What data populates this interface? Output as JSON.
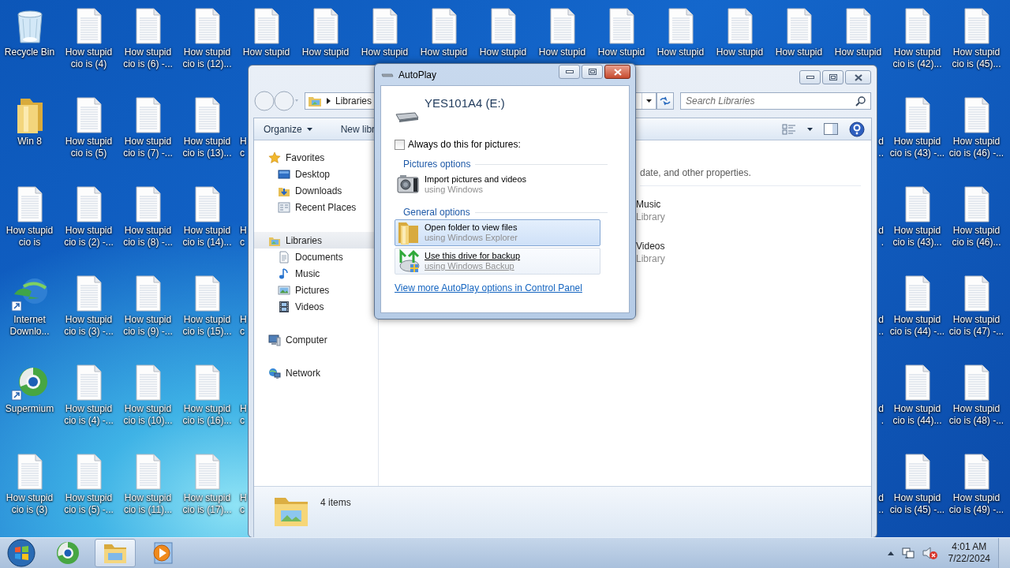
{
  "desktop": {
    "columns": [
      [
        {
          "kind": "recycle-bin",
          "lines": [
            "Recycle Bin"
          ]
        },
        {
          "kind": "folder",
          "lines": [
            "Win 8"
          ]
        },
        {
          "kind": "document",
          "lines": [
            "How stupid",
            "cio is"
          ]
        },
        {
          "kind": "downloader",
          "lines": [
            "Internet",
            "Downlo..."
          ]
        },
        {
          "kind": "browser",
          "lines": [
            "Supermium"
          ]
        },
        {
          "kind": "document",
          "lines": [
            "How stupid",
            "cio is (3)"
          ]
        }
      ],
      [
        {
          "kind": "document",
          "lines": [
            "How stupid",
            "cio is (4)"
          ]
        },
        {
          "kind": "document",
          "lines": [
            "How stupid",
            "cio is (5)"
          ]
        },
        {
          "kind": "document",
          "lines": [
            "How stupid",
            "cio is (2) -..."
          ]
        },
        {
          "kind": "document",
          "lines": [
            "How stupid",
            "cio is (3) -..."
          ]
        },
        {
          "kind": "document",
          "lines": [
            "How stupid",
            "cio is (4) -..."
          ]
        },
        {
          "kind": "document",
          "lines": [
            "How stupid",
            "cio is (5) -..."
          ]
        }
      ],
      [
        {
          "kind": "document",
          "lines": [
            "How stupid",
            "cio is (6) -..."
          ]
        },
        {
          "kind": "document",
          "lines": [
            "How stupid",
            "cio is (7) -..."
          ]
        },
        {
          "kind": "document",
          "lines": [
            "How stupid",
            "cio is (8) -..."
          ]
        },
        {
          "kind": "document",
          "lines": [
            "How stupid",
            "cio is (9) -..."
          ]
        },
        {
          "kind": "document",
          "lines": [
            "How stupid",
            "cio is (10)..."
          ]
        },
        {
          "kind": "document",
          "lines": [
            "How stupid",
            "cio is (11)..."
          ]
        }
      ],
      [
        {
          "kind": "document",
          "lines": [
            "How stupid",
            "cio is (12)..."
          ]
        },
        {
          "kind": "document",
          "lines": [
            "How stupid",
            "cio is (13)..."
          ]
        },
        {
          "kind": "document",
          "lines": [
            "How stupid",
            "cio is (14)..."
          ]
        },
        {
          "kind": "document",
          "lines": [
            "How stupid",
            "cio is (15)..."
          ]
        },
        {
          "kind": "document",
          "lines": [
            "How stupid",
            "cio is (16)..."
          ]
        },
        {
          "kind": "document",
          "lines": [
            "How stupid",
            "cio is (17)..."
          ]
        }
      ],
      [
        {
          "kind": "document",
          "lines": [
            "How stupid"
          ]
        },
        {
          "kind": "cut-left",
          "lines": [
            "H",
            "c"
          ]
        },
        {
          "kind": "cut-left",
          "lines": [
            "H",
            "c"
          ]
        },
        {
          "kind": "cut-left",
          "lines": [
            "H",
            "c"
          ]
        },
        {
          "kind": "cut-left",
          "lines": [
            "H",
            "c"
          ]
        },
        {
          "kind": "cut-left",
          "lines": [
            "H",
            "c"
          ]
        }
      ],
      [
        {
          "kind": "document",
          "lines": [
            "How stupid"
          ]
        }
      ],
      [
        {
          "kind": "document",
          "lines": [
            "How stupid"
          ]
        }
      ],
      [
        {
          "kind": "document",
          "lines": [
            "How stupid"
          ]
        }
      ],
      [
        {
          "kind": "document",
          "lines": [
            "How stupid"
          ]
        }
      ],
      [
        {
          "kind": "document",
          "lines": [
            "How stupid"
          ]
        }
      ],
      [
        {
          "kind": "document",
          "lines": [
            "How stupid"
          ]
        }
      ],
      [
        {
          "kind": "document",
          "lines": [
            "How stupid"
          ]
        }
      ],
      [
        {
          "kind": "document",
          "lines": [
            "How stupid"
          ]
        }
      ],
      [
        {
          "kind": "document",
          "lines": [
            "How stupid"
          ]
        }
      ],
      [
        {
          "kind": "document",
          "lines": [
            "How stupid"
          ]
        },
        {
          "kind": "cut-right",
          "lines": [
            "d",
            ".."
          ]
        },
        {
          "kind": "cut-right",
          "lines": [
            "d",
            "."
          ]
        },
        {
          "kind": "cut-right",
          "lines": [
            "d",
            ".."
          ]
        },
        {
          "kind": "cut-right",
          "lines": [
            "d",
            "."
          ]
        },
        {
          "kind": "cut-right",
          "lines": [
            "d",
            ".."
          ]
        }
      ],
      [
        {
          "kind": "document",
          "lines": [
            "How stupid",
            "cio is (42)..."
          ]
        },
        {
          "kind": "document",
          "lines": [
            "How stupid",
            "cio is (43) -..."
          ]
        },
        {
          "kind": "document",
          "lines": [
            "How stupid",
            "cio is (43)..."
          ]
        },
        {
          "kind": "document",
          "lines": [
            "How stupid",
            "cio is (44) -..."
          ]
        },
        {
          "kind": "document",
          "lines": [
            "How stupid",
            "cio is (44)..."
          ]
        },
        {
          "kind": "document",
          "lines": [
            "How stupid",
            "cio is (45) -..."
          ]
        }
      ],
      [
        {
          "kind": "document",
          "lines": [
            "How stupid",
            "cio is (45)..."
          ]
        },
        {
          "kind": "document",
          "lines": [
            "How stupid",
            "cio is (46) -..."
          ]
        },
        {
          "kind": "document",
          "lines": [
            "How stupid",
            "cio is (46)..."
          ]
        },
        {
          "kind": "document",
          "lines": [
            "How stupid",
            "cio is (47) -..."
          ]
        },
        {
          "kind": "document",
          "lines": [
            "How stupid",
            "cio is (48) -..."
          ]
        },
        {
          "kind": "document",
          "lines": [
            "How stupid",
            "cio is (49) -..."
          ]
        }
      ]
    ]
  },
  "explorer": {
    "address": "Libraries",
    "search": {
      "placeholder": "Search Libraries"
    },
    "toolbar": [
      {
        "label": "Organize",
        "dropdown": true
      },
      {
        "label": "New libr",
        "dropdown": false
      }
    ],
    "nav": [
      {
        "label": "Favorites",
        "kind": "star",
        "selected": false,
        "children": [
          {
            "label": "Desktop",
            "kind": "desktop",
            "selected": false
          },
          {
            "label": "Downloads",
            "kind": "downloads",
            "selected": false
          },
          {
            "label": "Recent Places",
            "kind": "recent",
            "selected": false
          }
        ]
      },
      {
        "label": "Libraries",
        "kind": "libraries",
        "selected": true,
        "children": [
          {
            "label": "Documents",
            "kind": "documents",
            "selected": false
          },
          {
            "label": "Music",
            "kind": "music",
            "selected": false
          },
          {
            "label": "Pictures",
            "kind": "pictures",
            "selected": false
          },
          {
            "label": "Videos",
            "kind": "videos",
            "selected": false
          }
        ]
      },
      {
        "label": "Computer",
        "kind": "computer",
        "selected": false
      },
      {
        "label": "Network",
        "kind": "network",
        "selected": false
      }
    ],
    "content": {
      "description": "date, and other properties.",
      "libraries": [
        {
          "name": "Music",
          "type": "Library"
        },
        {
          "name": "Videos",
          "type": "Library"
        }
      ]
    },
    "status": "4 items"
  },
  "autoplay": {
    "title": "AutoPlay",
    "drive": "YES101A4 (E:)",
    "always": {
      "label": "Always do this for pictures:",
      "checked": false
    },
    "sections": [
      {
        "title": "Pictures options",
        "options": [
          {
            "kind": "camera",
            "title": "Import pictures and videos",
            "subtitle": "using Windows",
            "selected": false,
            "hovered": false
          }
        ]
      },
      {
        "title": "General options",
        "options": [
          {
            "kind": "folder",
            "title": "Open folder to view files",
            "subtitle": "using Windows Explorer",
            "selected": true,
            "hovered": false
          },
          {
            "kind": "backup",
            "title": "Use this drive for backup",
            "subtitle": "using Windows Backup",
            "selected": false,
            "hovered": true
          }
        ]
      }
    ],
    "link": "View more AutoPlay options in Control Panel"
  },
  "taskbar": {
    "apps": [
      {
        "kind": "browser",
        "active": false
      },
      {
        "kind": "explorer",
        "active": true
      },
      {
        "kind": "media",
        "active": false
      }
    ],
    "clock": {
      "time": "4:01 AM",
      "date": "7/22/2024"
    }
  }
}
